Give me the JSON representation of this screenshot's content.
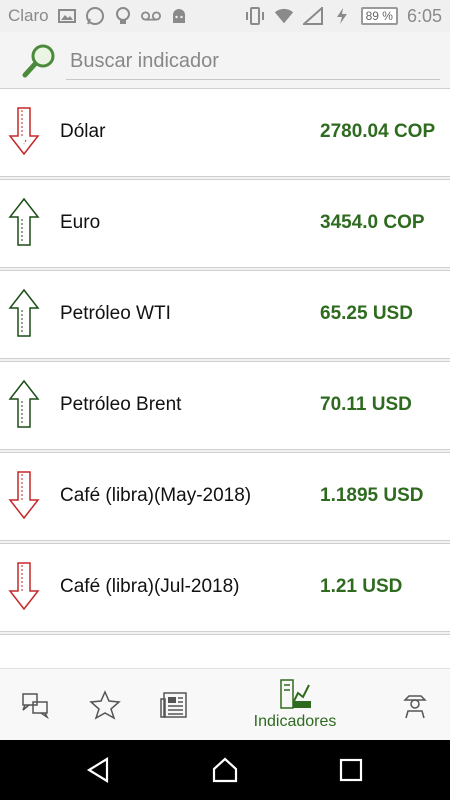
{
  "status_bar": {
    "carrier": "Claro",
    "battery": "89 %",
    "time": "6:05"
  },
  "search": {
    "placeholder": "Buscar indicador"
  },
  "indicators": [
    {
      "name": "Dólar",
      "value": "2780.04 COP",
      "trend": "down"
    },
    {
      "name": "Euro",
      "value": "3454.0 COP",
      "trend": "up"
    },
    {
      "name": "Petróleo WTI",
      "value": "65.25 USD",
      "trend": "up"
    },
    {
      "name": "Petróleo Brent",
      "value": "70.11 USD",
      "trend": "up"
    },
    {
      "name": "Café (libra)(May-2018)",
      "value": "1.1895 USD",
      "trend": "down"
    },
    {
      "name": "Café (libra)(Jul-2018)",
      "value": "1.21 USD",
      "trend": "down"
    }
  ],
  "bottom_nav": {
    "items": [
      {
        "icon": "chat-icon"
      },
      {
        "icon": "star-icon"
      },
      {
        "icon": "newspaper-icon"
      },
      {
        "icon": "chart-building-icon",
        "label": "Indicadores",
        "active": true
      },
      {
        "icon": "farmer-icon"
      }
    ]
  },
  "colors": {
    "accent": "#2e6b1f",
    "down": "#c62828",
    "up": "#1b4d17"
  }
}
